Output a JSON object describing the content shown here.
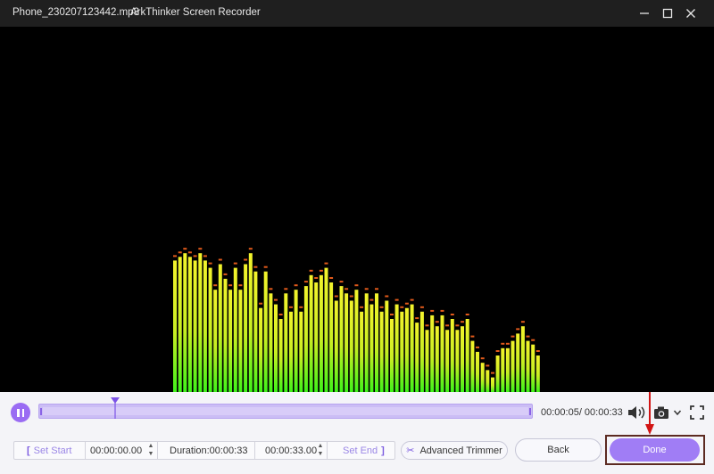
{
  "window": {
    "filename": "Phone_230207123442.mp3",
    "app_title": "ArkThinker Screen Recorder",
    "controls": [
      "minimize-icon",
      "maximize-icon",
      "close-icon"
    ]
  },
  "visualizer": {
    "bar_color_top": "#f3f32c",
    "bar_color_bottom": "#3ef21a",
    "peak_color": "#e25a1b",
    "levels": [
      0.36,
      0.37,
      0.38,
      0.37,
      0.36,
      0.38,
      0.36,
      0.34,
      0.28,
      0.35,
      0.31,
      0.28,
      0.34,
      0.28,
      0.35,
      0.38,
      0.33,
      0.23,
      0.33,
      0.27,
      0.24,
      0.2,
      0.27,
      0.22,
      0.28,
      0.22,
      0.29,
      0.32,
      0.3,
      0.32,
      0.34,
      0.3,
      0.25,
      0.29,
      0.27,
      0.25,
      0.28,
      0.22,
      0.27,
      0.24,
      0.27,
      0.22,
      0.25,
      0.2,
      0.24,
      0.22,
      0.23,
      0.24,
      0.19,
      0.22,
      0.17,
      0.21,
      0.18,
      0.21,
      0.17,
      0.2,
      0.17,
      0.18,
      0.2,
      0.14,
      0.11,
      0.08,
      0.06,
      0.04,
      0.1,
      0.12,
      0.12,
      0.14,
      0.16,
      0.18,
      0.14,
      0.13,
      0.1
    ]
  },
  "player": {
    "pause_icon": "pause-icon",
    "progress_fraction": 0.15,
    "current_time": "00:00:05",
    "total_time": "00:00:33",
    "timecode_text": "00:00:05/ 00:00:33",
    "volume_icon": "volume-icon",
    "screenshot_icon": "camera-icon",
    "fullscreen_icon": "fullscreen-icon"
  },
  "trim": {
    "set_start_label": "Set Start",
    "start_time": "00:00:00.00",
    "duration_label": "Duration:00:00:33",
    "end_time": "00:00:33.00",
    "set_end_label": "Set End",
    "advanced_trimmer_label": "Advanced Trimmer"
  },
  "actions": {
    "back_label": "Back",
    "done_label": "Done"
  },
  "colors": {
    "accent": "#a07df5",
    "highlight_outline": "#5c2a21",
    "annotation_arrow": "#d21414"
  }
}
